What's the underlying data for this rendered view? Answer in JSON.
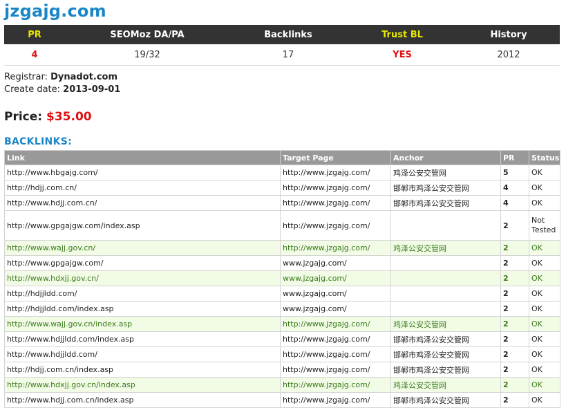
{
  "domain_title": "jzgajg.com",
  "stats": {
    "headers": [
      "PR",
      "SEOMoz DA/PA",
      "Backlinks",
      "Trust BL",
      "History"
    ],
    "values": [
      "4",
      "19/32",
      "17",
      "YES",
      "2012"
    ]
  },
  "registrar": {
    "label": "Registrar:",
    "value": "Dynadot.com"
  },
  "create_date": {
    "label": "Create date:",
    "value": "2013-09-01"
  },
  "price": {
    "label": "Price:",
    "value": "$35.00"
  },
  "backlinks_heading": "BACKLINKS:",
  "backlinks": {
    "headers": [
      "Link",
      "Target Page",
      "Anchor",
      "PR",
      "Status"
    ],
    "rows": [
      {
        "link": "http://www.hbgajg.com/",
        "target": "http://www.jzgajg.com/",
        "anchor": "鸡泽公安交管网",
        "pr": "5",
        "status": "OK",
        "highlight": false
      },
      {
        "link": "http://hdjj.com.cn/",
        "target": "http://www.jzgajg.com/",
        "anchor": "邯郸市鸡泽公安交管网",
        "pr": "4",
        "status": "OK",
        "highlight": false
      },
      {
        "link": "http://www.hdjj.com.cn/",
        "target": "http://www.jzgajg.com/",
        "anchor": "邯郸市鸡泽公安交管网",
        "pr": "4",
        "status": "OK",
        "highlight": false
      },
      {
        "link": "http://www.gpgajgw.com/index.asp",
        "target": "http://www.jzgajg.com/",
        "anchor": "",
        "pr": "2",
        "status": "Not Tested",
        "highlight": false
      },
      {
        "link": "http://www.wajj.gov.cn/",
        "target": "http://www.jzgajg.com/",
        "anchor": "鸡泽公安交管网",
        "pr": "2",
        "status": "OK",
        "highlight": true
      },
      {
        "link": "http://www.gpgajgw.com/",
        "target": "www.jzgajg.com/",
        "anchor": "",
        "pr": "2",
        "status": "OK",
        "highlight": false
      },
      {
        "link": "http://www.hdxjj.gov.cn/",
        "target": "www.jzgajg.com/",
        "anchor": "",
        "pr": "2",
        "status": "OK",
        "highlight": true
      },
      {
        "link": "http://hdjjldd.com/",
        "target": "www.jzgajg.com/",
        "anchor": "",
        "pr": "2",
        "status": "OK",
        "highlight": false
      },
      {
        "link": "http://hdjjldd.com/index.asp",
        "target": "www.jzgajg.com/",
        "anchor": "",
        "pr": "2",
        "status": "OK",
        "highlight": false
      },
      {
        "link": "http://www.wajj.gov.cn/index.asp",
        "target": "http://www.jzgajg.com/",
        "anchor": "鸡泽公安交管网",
        "pr": "2",
        "status": "OK",
        "highlight": true
      },
      {
        "link": "http://www.hdjjldd.com/index.asp",
        "target": "http://www.jzgajg.com/",
        "anchor": "邯郸市鸡泽公安交管网",
        "pr": "2",
        "status": "OK",
        "highlight": false
      },
      {
        "link": "http://www.hdjjldd.com/",
        "target": "http://www.jzgajg.com/",
        "anchor": "邯郸市鸡泽公安交管网",
        "pr": "2",
        "status": "OK",
        "highlight": false
      },
      {
        "link": "http://hdjj.com.cn/index.asp",
        "target": "http://www.jzgajg.com/",
        "anchor": "邯郸市鸡泽公安交管网",
        "pr": "2",
        "status": "OK",
        "highlight": false
      },
      {
        "link": "http://www.hdxjj.gov.cn/index.asp",
        "target": "http://www.jzgajg.com/",
        "anchor": "鸡泽公安交管网",
        "pr": "2",
        "status": "OK",
        "highlight": true
      },
      {
        "link": "http://www.hdjj.com.cn/index.asp",
        "target": "http://www.jzgajg.com/",
        "anchor": "邯郸市鸡泽公安交管网",
        "pr": "2",
        "status": "OK",
        "highlight": false
      }
    ]
  },
  "colors": {
    "title_blue": "#1a86c8",
    "header_dark": "#333333",
    "header_yellow": "#e8e800",
    "red": "#dd1111",
    "table_header_gray": "#999999",
    "highlight_row_bg": "#f1fbe6",
    "highlight_row_text": "#3a7a1a"
  }
}
